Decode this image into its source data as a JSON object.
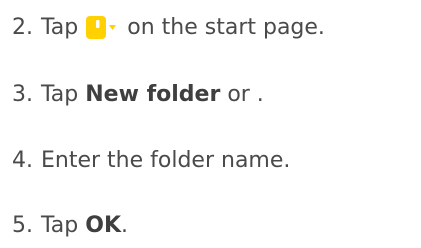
{
  "steps": [
    {
      "number": "2.",
      "before": "Tap",
      "icon": "folder-dropdown-icon",
      "after": "on the start page."
    },
    {
      "number": "3.",
      "before": "Tap",
      "strong": "New folder",
      "after": "or ."
    },
    {
      "number": "4.",
      "text": "Enter the folder name."
    },
    {
      "number": "5.",
      "before": "Tap",
      "strong": "OK",
      "after": "."
    }
  ],
  "colors": {
    "text": "#4a4a4a",
    "icon_yellow": "#ffd100"
  }
}
